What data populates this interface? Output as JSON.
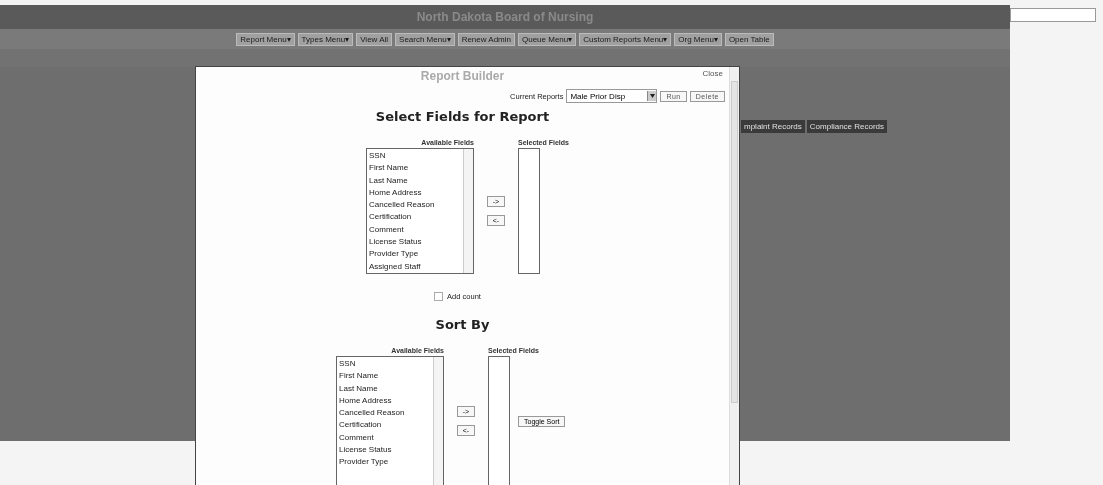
{
  "page": {
    "title": "North Dakota Board of Nursing",
    "menu": [
      "Report Menu▾",
      "Types Menu▾",
      "View All",
      "Search Menu▾",
      "Renew Admin",
      "Queue Menu▾",
      "Custom Reports Menu▾",
      "Org Menu▾",
      "Open Table"
    ],
    "tabs": [
      "mplaint Records",
      "Compliance Records"
    ]
  },
  "dialog": {
    "title": "Report Builder",
    "close": "Close",
    "current_reports_label": "Current Reports",
    "current_report": "Male Prior Disp",
    "buttons": [
      "Run",
      "Delete"
    ],
    "select_fields": {
      "heading": "Select Fields for Report",
      "available_label": "Available Fields",
      "selected_label": "Selected Fields",
      "available": [
        "SSN",
        "First Name",
        "Last Name",
        "Home Address",
        "Cancelled Reason",
        "Certification",
        "Comment",
        "License Status",
        "Provider Type",
        "Assigned Staff"
      ],
      "add_button": "->",
      "remove_button": "<-",
      "add_count": {
        "label": "Add count",
        "checked": false
      }
    },
    "sort_by": {
      "heading": "Sort By",
      "available_label": "Available Fields",
      "selected_label": "Selected Fields",
      "available": [
        "SSN",
        "First Name",
        "Last Name",
        "Home Address",
        "Cancelled Reason",
        "Certification",
        "Comment",
        "License Status",
        "Provider Type"
      ],
      "add_button": "->",
      "remove_button": "<-",
      "toggle_button": "Toggle Sort"
    }
  }
}
